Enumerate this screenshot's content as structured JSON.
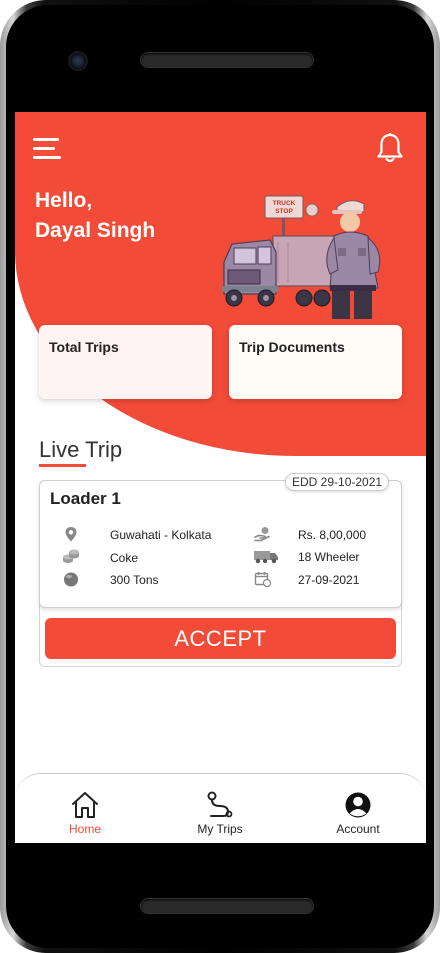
{
  "header": {
    "greeting_line1": "Hello,",
    "greeting_line2": "Dayal Singh",
    "illustration_sign": "TRUCK STOP"
  },
  "cards": {
    "total_trips": "Total Trips",
    "trip_documents": "Trip Documents"
  },
  "live_trip": {
    "section_title": "Live Trip",
    "edd": "EDD 29-10-2021",
    "loader": "Loader 1",
    "route": "Guwahati - Kolkata",
    "material": "Coke",
    "weight": "300 Tons",
    "amount": "Rs. 8,00,000",
    "vehicle": "18 Wheeler",
    "date": "27-09-2021",
    "accept_label": "ACCEPT"
  },
  "nav": {
    "home": "Home",
    "my_trips": "My Trips",
    "account": "Account"
  },
  "colors": {
    "accent": "#f24b37",
    "active_nav": "#f24b37"
  },
  "icons": [
    "menu-icon",
    "bell-icon",
    "location-pin-icon",
    "coins-icon",
    "weight-icon",
    "money-hand-icon",
    "truck-icon",
    "calendar-icon",
    "home-icon",
    "route-icon",
    "account-icon"
  ]
}
